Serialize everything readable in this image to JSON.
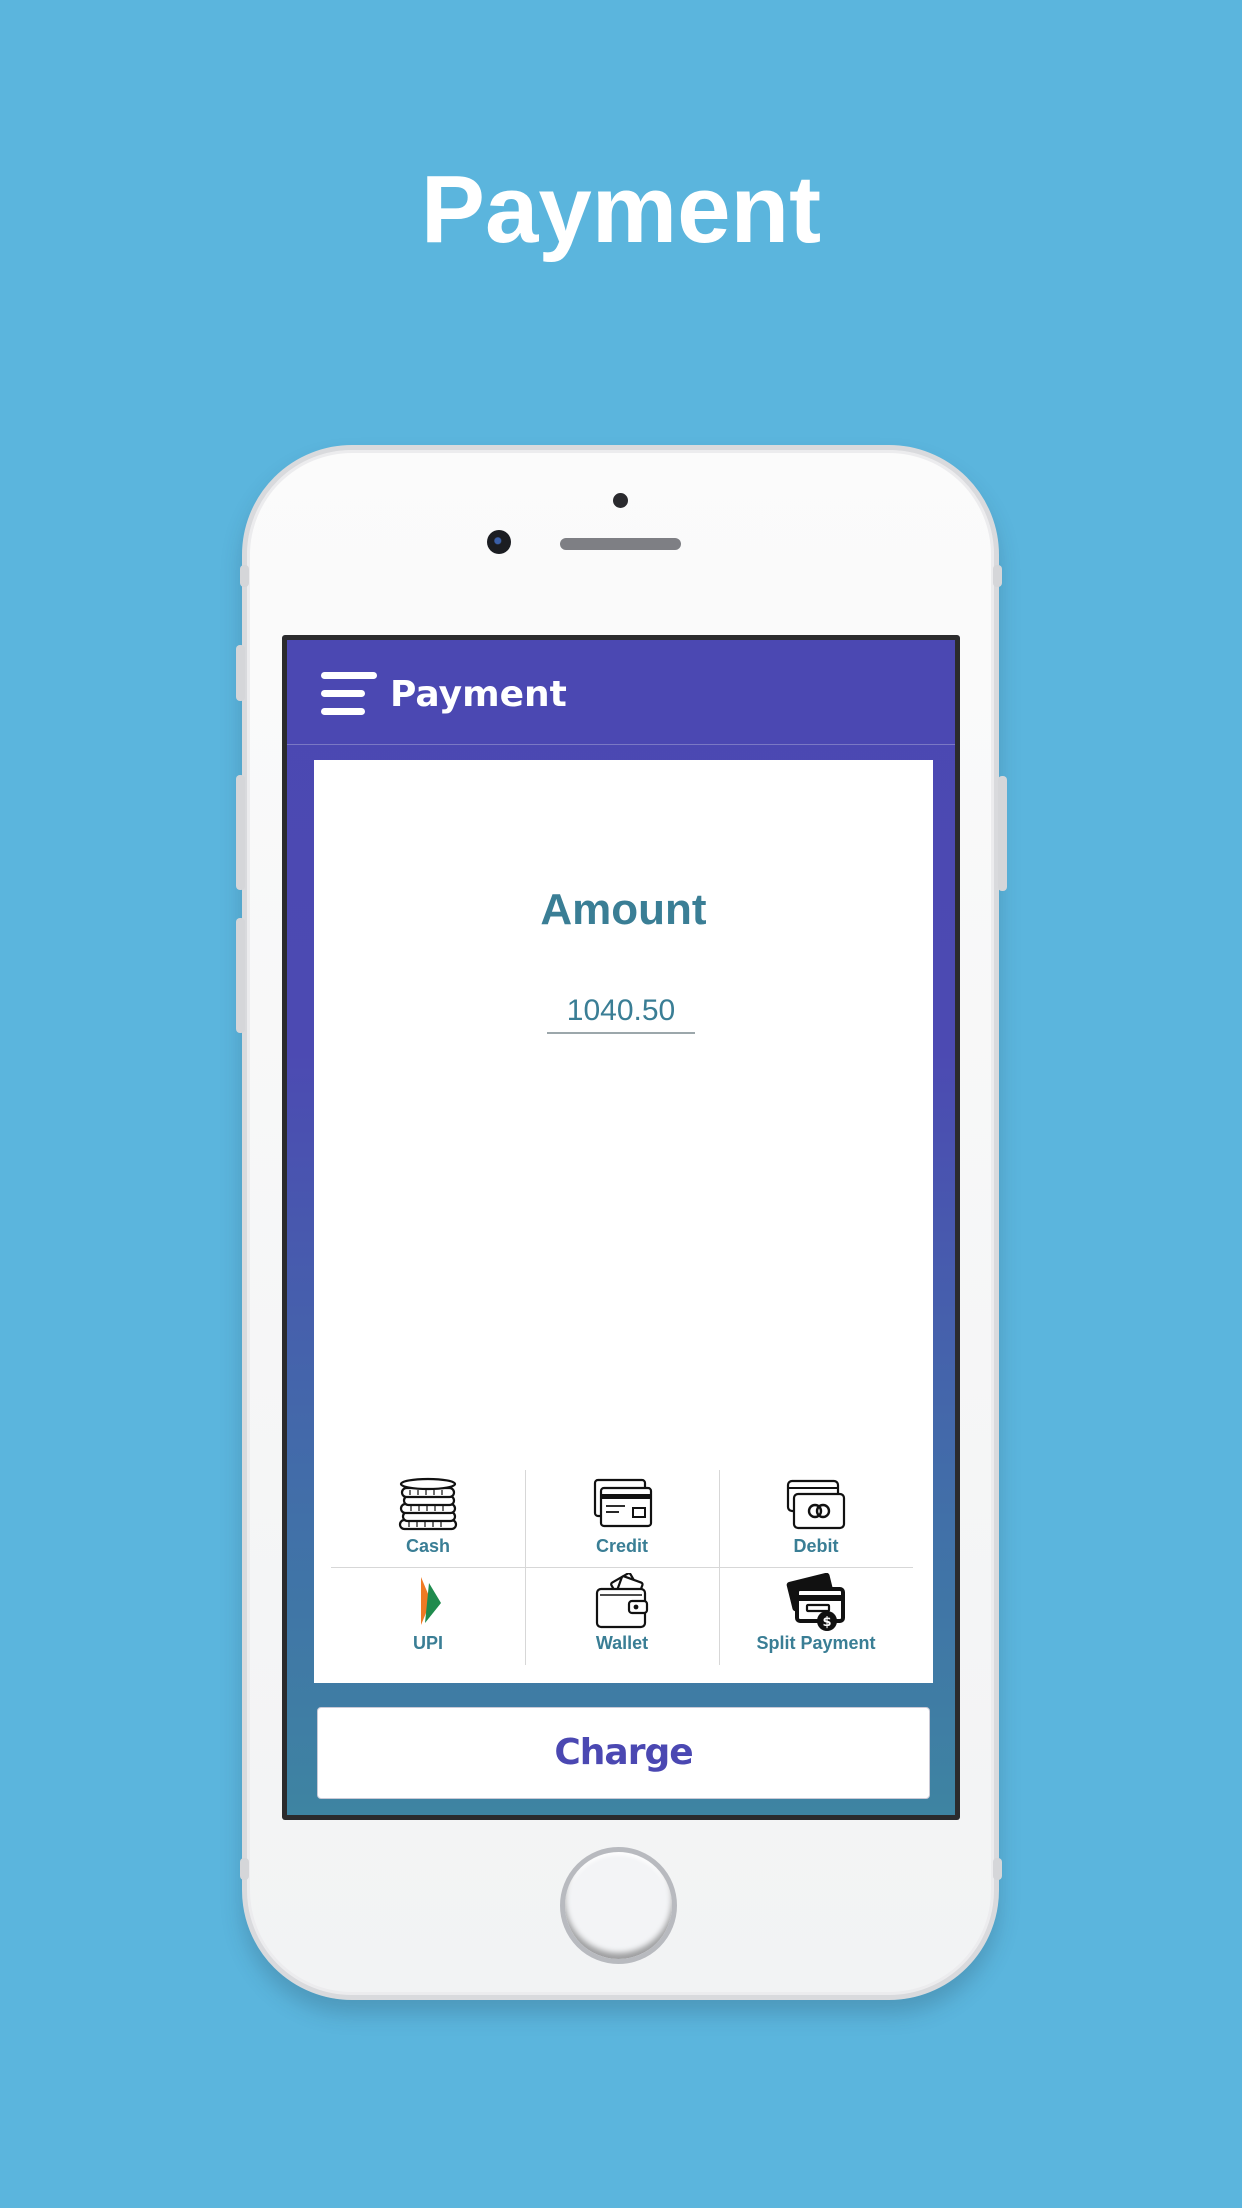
{
  "page": {
    "headline": "Payment",
    "background_color": "#5bb5dd"
  },
  "app": {
    "title": "Payment",
    "accent_color": "#4b48b2",
    "text_color": "#3a7e95"
  },
  "amount": {
    "label": "Amount",
    "value": "1040.50"
  },
  "payment_methods": [
    {
      "label": "Cash",
      "icon": "coins-icon"
    },
    {
      "label": "Credit",
      "icon": "credit-card-icon"
    },
    {
      "label": "Debit",
      "icon": "debit-card-icon"
    },
    {
      "label": "UPI",
      "icon": "upi-logo-icon"
    },
    {
      "label": "Wallet",
      "icon": "wallet-icon"
    },
    {
      "label": "Split Payment",
      "icon": "split-payment-icon"
    }
  ],
  "charge_button": {
    "label": "Charge"
  }
}
